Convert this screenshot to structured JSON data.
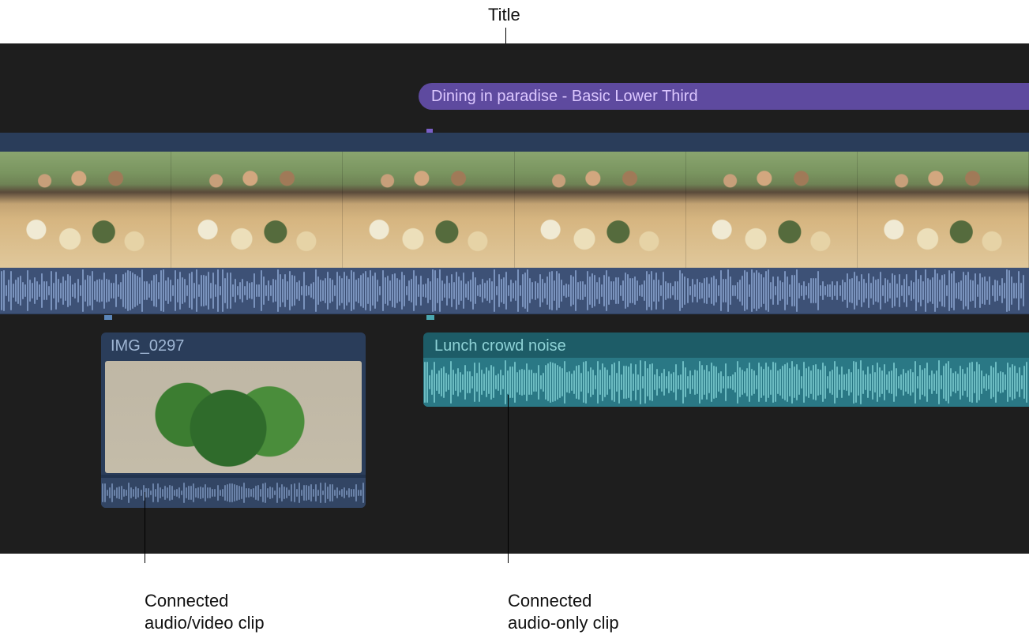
{
  "annotations": {
    "title": "Title",
    "connected_av": "Connected\naudio/video clip",
    "connected_audio": "Connected\naudio-only clip"
  },
  "timeline": {
    "title_clip": {
      "label": "Dining in paradise - Basic Lower Third"
    },
    "connected_av_clip": {
      "label": "IMG_0297"
    },
    "connected_audio_clip": {
      "label": "Lunch crowd noise"
    }
  }
}
